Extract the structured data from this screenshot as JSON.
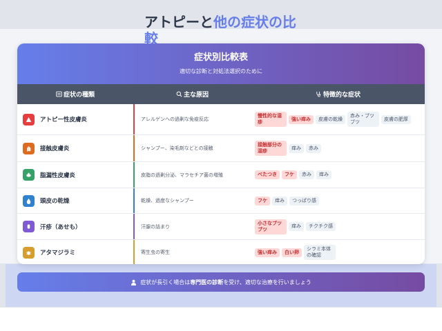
{
  "page": {
    "title_main": "アトピーと",
    "title_accent": "他の症状の比較"
  },
  "card": {
    "title": "症状別比較表",
    "subtitle": "適切な診断と対処法選択のために"
  },
  "columns": [
    {
      "label": "症状の種類",
      "icon": "list-icon"
    },
    {
      "label": "主な原因",
      "icon": "search-icon"
    },
    {
      "label": "特徴的な症状",
      "icon": "stethoscope-icon"
    }
  ],
  "rows": [
    {
      "name": "アトピー性皮膚炎",
      "icon": "warning-icon",
      "icon_color": "#e53e3e",
      "border_color": "#e53e3e",
      "cause": "アレルゲンへの過剰な免疫反応",
      "tags": [
        {
          "text": "慢性的な湿疹",
          "hl": true
        },
        {
          "text": "強い痒み",
          "hl": true
        },
        {
          "text": "皮膚の乾燥",
          "hl": false
        },
        {
          "text": "赤み・ブツブツ",
          "hl": false
        },
        {
          "text": "皮膚の肥厚",
          "hl": false
        }
      ]
    },
    {
      "name": "接触皮膚炎",
      "icon": "hand-icon",
      "icon_color": "#dd6b20",
      "border_color": "#dd6b20",
      "cause": "シャンプー、染毛剤などとの接触",
      "tags": [
        {
          "text": "接触部分の湿疹",
          "hl": true
        },
        {
          "text": "痒み",
          "hl": false
        },
        {
          "text": "赤み",
          "hl": false
        }
      ]
    },
    {
      "name": "脂漏性皮膚炎",
      "icon": "oil-icon",
      "icon_color": "#38a169",
      "border_color": "#38a169",
      "cause": "皮脂の過剰分泌、マラセチア菌の増殖",
      "tags": [
        {
          "text": "べたつき",
          "hl": true
        },
        {
          "text": "フケ",
          "hl": true
        },
        {
          "text": "赤み",
          "hl": false
        },
        {
          "text": "痒み",
          "hl": false
        }
      ]
    },
    {
      "name": "頭皮の乾燥",
      "icon": "droplet-icon",
      "icon_color": "#3182ce",
      "border_color": "#3182ce",
      "cause": "乾燥、過度なシャンプー",
      "tags": [
        {
          "text": "フケ",
          "hl": true
        },
        {
          "text": "痒み",
          "hl": false
        },
        {
          "text": "つっぱり感",
          "hl": false
        }
      ]
    },
    {
      "name": "汗疹（あせも）",
      "icon": "sweat-icon",
      "icon_color": "#805ad5",
      "border_color": "#805ad5",
      "cause": "汗腺の詰まり",
      "tags": [
        {
          "text": "小さなブツブツ",
          "hl": true
        },
        {
          "text": "痒み",
          "hl": false
        },
        {
          "text": "チクチク感",
          "hl": false
        }
      ]
    },
    {
      "name": "アタマジラミ",
      "icon": "bug-icon",
      "icon_color": "#d69e2e",
      "border_color": "#d69e2e",
      "cause": "寄生虫の寄生",
      "tags": [
        {
          "text": "強い痒み",
          "hl": true
        },
        {
          "text": "白い卵",
          "hl": true
        },
        {
          "text": "シラミ本体の確認",
          "hl": false
        }
      ]
    }
  ],
  "footer": {
    "pre": "症状が長引く場合は",
    "strong": "専門医の診断",
    "post": "を受け、適切な治療を行いましょう",
    "icon": "doctor-icon"
  }
}
